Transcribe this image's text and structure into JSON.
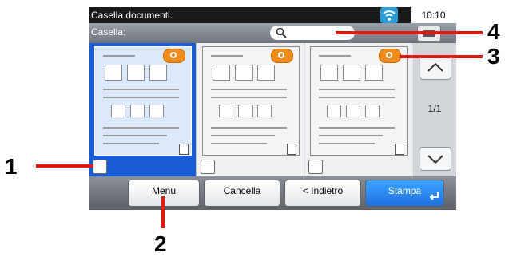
{
  "header": {
    "title": "Casella documenti.",
    "time": "10:10"
  },
  "box_bar": {
    "label": "Casella:"
  },
  "pagination": {
    "page_indicator": "1/1"
  },
  "footer": {
    "menu_label": "Menu",
    "delete_label": "Cancella",
    "back_label": "< Indietro",
    "print_label": "Stampa"
  },
  "callouts": {
    "c1": "1",
    "c2": "2",
    "c3": "3",
    "c4": "4"
  },
  "colors": {
    "callout_line": "#e01a12",
    "selected": "#1a5bd6",
    "primary_button": "#1f6fe0",
    "badge": "#ef8c1c",
    "wifi": "#2a9bd6"
  }
}
